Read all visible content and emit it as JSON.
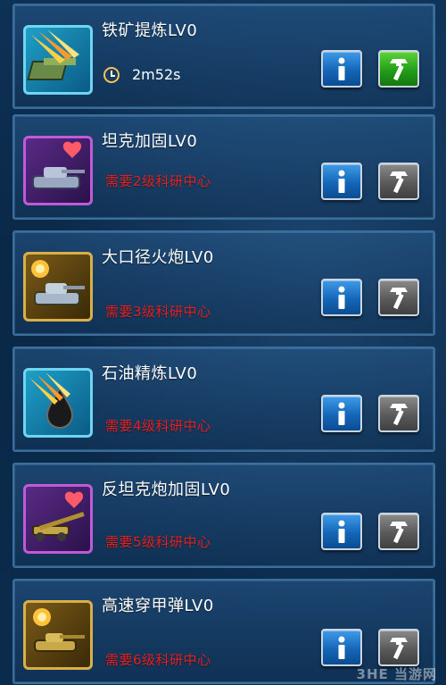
{
  "items": [
    {
      "title": "铁矿提炼LV0",
      "timer": "2m52s",
      "requirement": "",
      "thumb_style": "cyan",
      "thumb_icon": "ore-refining-icon",
      "build_state": "available"
    },
    {
      "title": "坦克加固LV0",
      "timer": "",
      "requirement": "需要2级科研中心",
      "thumb_style": "purple",
      "thumb_icon": "tank-armor-icon",
      "build_state": "locked"
    },
    {
      "title": "大口径火炮LV0",
      "timer": "",
      "requirement": "需要3级科研中心",
      "thumb_style": "gold",
      "thumb_icon": "heavy-cannon-icon",
      "build_state": "locked"
    },
    {
      "title": "石油精炼LV0",
      "timer": "",
      "requirement": "需要4级科研中心",
      "thumb_style": "cyan",
      "thumb_icon": "oil-refining-icon",
      "build_state": "locked"
    },
    {
      "title": "反坦克炮加固LV0",
      "timer": "",
      "requirement": "需要5级科研中心",
      "thumb_style": "purple",
      "thumb_icon": "anti-tank-armor-icon",
      "build_state": "locked"
    },
    {
      "title": "高速穿甲弹LV0",
      "timer": "",
      "requirement": "需要6级科研中心",
      "thumb_style": "gold",
      "thumb_icon": "ap-shell-icon",
      "build_state": "locked"
    }
  ],
  "colors": {
    "requirement_text": "#e52020",
    "info_button": "#1466b8",
    "build_available": "#239e18",
    "build_locked": "#5a5a5a"
  },
  "watermark": "3HE 当游网"
}
